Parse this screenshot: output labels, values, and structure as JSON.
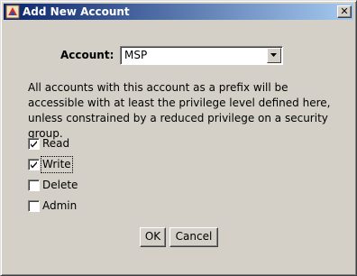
{
  "window": {
    "title": "Add New Account",
    "close_glyph": "✕"
  },
  "form": {
    "account_label": "Account:",
    "account_value": "MSP",
    "description": "All accounts with this account as a prefix will be\naccessible with at least the privilege level defined here,\nunless constrained by a reduced privilege on a security group."
  },
  "privileges": [
    {
      "label": "Read",
      "checked": true
    },
    {
      "label": "Write",
      "checked": true
    },
    {
      "label": "Delete",
      "checked": false
    },
    {
      "label": "Admin",
      "checked": false
    }
  ],
  "buttons": {
    "ok": "OK",
    "cancel": "Cancel"
  },
  "icons": {
    "title": "app-icon",
    "dropdown": "chevron-down-icon",
    "check": "checkmark-icon"
  }
}
